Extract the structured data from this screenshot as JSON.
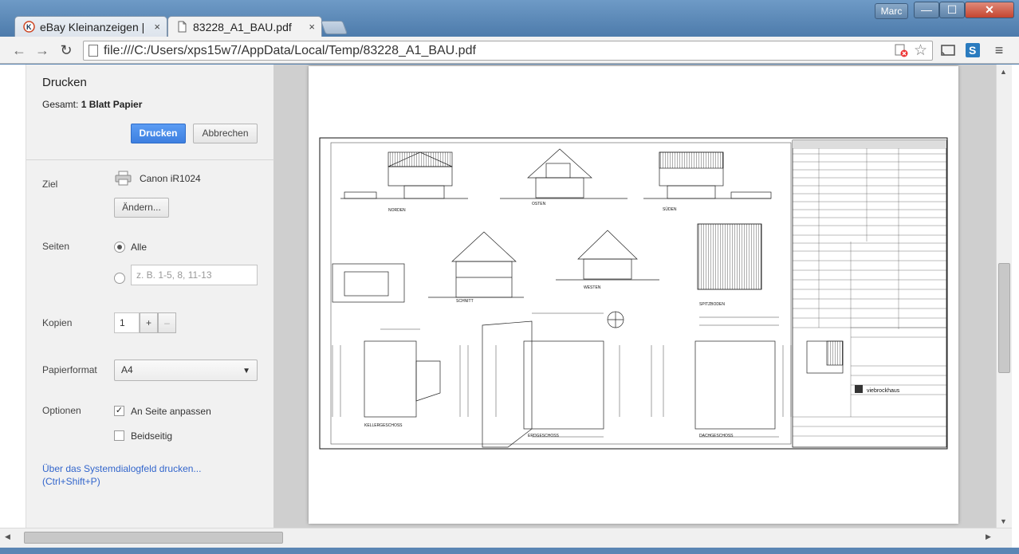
{
  "tabs": [
    {
      "title": "eBay Kleinanzeigen | ",
      "close": "×",
      "active": false
    },
    {
      "title": "83228_A1_BAU.pdf",
      "close": "×",
      "active": true
    }
  ],
  "window": {
    "user": "Marc",
    "minimize": "—",
    "maximize": "☐",
    "close": "✕"
  },
  "toolbar": {
    "back_icon": "←",
    "forward_icon": "→",
    "reload_icon": "↻",
    "url": "file:///C:/Users/xps15w7/AppData/Local/Temp/83228_A1_BAU.pdf",
    "blocked_icon": "✖",
    "star_icon": "☆",
    "menu_icon": "≡"
  },
  "print": {
    "title": "Drucken",
    "total_label": "Gesamt:",
    "total_value": "1 Blatt Papier",
    "print_button": "Drucken",
    "cancel_button": "Abbrechen",
    "destination_label": "Ziel",
    "printer_name": "Canon iR1024",
    "change_button": "Ändern...",
    "pages_label": "Seiten",
    "pages_all": "Alle",
    "pages_placeholder": "z. B. 1-5, 8, 11-13",
    "copies_label": "Kopien",
    "copies_value": "1",
    "copies_plus": "+",
    "copies_minus": "–",
    "paper_label": "Papierformat",
    "paper_value": "A4",
    "options_label": "Optionen",
    "fit_to_page": "An Seite anpassen",
    "fit_checked": true,
    "duplex": "Beidseitig",
    "duplex_checked": false,
    "system_dialog_link": "Über das Systemdialogfeld drucken...",
    "system_dialog_shortcut": "(Ctrl+Shift+P)"
  },
  "drawing_labels": {
    "north": "NORDEN",
    "east": "OSTEN",
    "south": "SÜDEN",
    "west": "WESTEN",
    "section": "SCHNITT",
    "attic": "SPITZBODEN",
    "basement": "KELLERGESCHOSS",
    "ground": "ERDGESCHOSS",
    "roof": "DACHGESCHOSS",
    "company": "viebrockhaus"
  },
  "colors": {
    "accent": "#3d7fe0",
    "chrome": "#5b86b4",
    "panel": "#f1f1f1"
  }
}
